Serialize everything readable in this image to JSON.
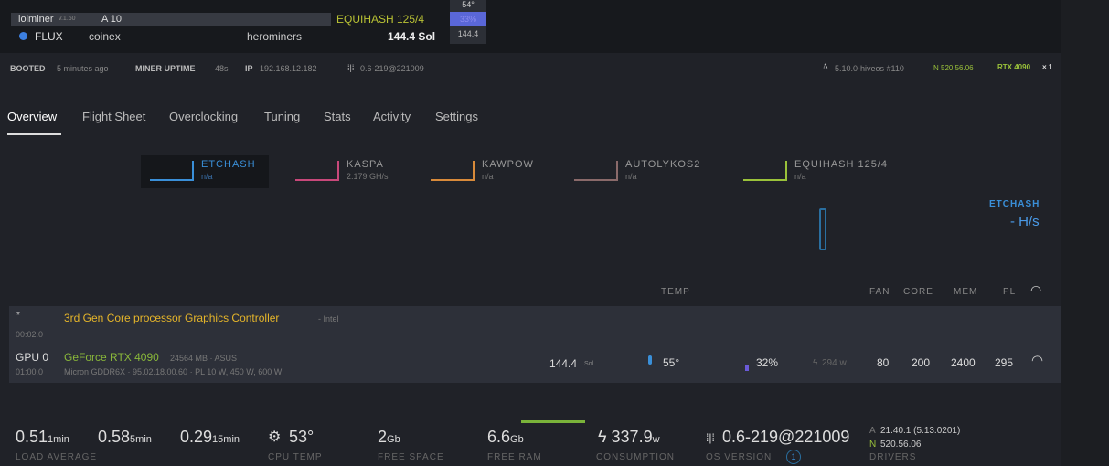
{
  "miner": {
    "name": "lolminer",
    "version": "v.1.60",
    "gpus": "A 10",
    "algo": "EQUIHASH 125/4",
    "coin": "FLUX",
    "wallet": "coinex",
    "pool": "herominers",
    "hashrate": "144.4 Sol",
    "mini_temp": "54°",
    "mini_fan": "33%",
    "mini_hash": "144.4"
  },
  "info": {
    "booted_label": "BOOTED",
    "booted": "5 minutes ago",
    "uptime_label": "MINER UPTIME",
    "uptime": "48s",
    "ip_label": "IP",
    "ip": "192.168.12.182",
    "os": "0.6-219@221009",
    "kernel": "5.10.0-hiveos #110",
    "nvidia": "N 520.56.06",
    "gpu_model": "RTX 4090",
    "gpu_count": "× 1"
  },
  "tabs": [
    "Overview",
    "Flight Sheet",
    "Overclocking",
    "Tuning",
    "Stats",
    "Activity",
    "Settings"
  ],
  "active_tab": 0,
  "algos": [
    {
      "name": "ETCHASH",
      "value": "n/a",
      "color": "#3a8fd8"
    },
    {
      "name": "KASPA",
      "value": "2.179 GH/s",
      "color": "#c8487a"
    },
    {
      "name": "KAWPOW",
      "value": "n/a",
      "color": "#d88a3a"
    },
    {
      "name": "AUTOLYKOS2",
      "value": "n/a",
      "color": "#8a6a6a"
    },
    {
      "name": "EQUIHASH 125/4",
      "value": "n/a",
      "color": "#9ac23a"
    }
  ],
  "chart_label": {
    "algo": "ETCHASH",
    "value": "- H/s"
  },
  "columns": {
    "temp": "TEMP",
    "fan": "FAN",
    "core": "CORE",
    "mem": "MEM",
    "pl": "PL"
  },
  "igpu": {
    "index": "*",
    "bus": "00:02.0",
    "name": "3rd Gen Core processor Graphics Controller",
    "vendor": "- Intel"
  },
  "gpu": {
    "index": "GPU 0",
    "bus": "01:00.0",
    "name": "GeForce RTX 4090",
    "mem": "24564 MB · ASUS",
    "details": "Micron GDDR6X · 95.02.18.00.60 · PL 10 W, 450 W, 600 W",
    "hash": "144.4",
    "hash_unit": "Sol",
    "temp": "55°",
    "fan_pct": "32%",
    "power": "294 w",
    "fan": "80",
    "core": "200",
    "mem_clock": "2400",
    "pl": "295"
  },
  "stats": {
    "load1": "0.51",
    "load1_u": "1min",
    "load5": "0.58",
    "load5_u": "5min",
    "load15": "0.29",
    "load15_u": "15min",
    "load_label": "LOAD AVERAGE",
    "cpu_temp": "53°",
    "cpu_label": "CPU TEMP",
    "free_space": "2",
    "free_space_u": "Gb",
    "free_space_label": "FREE SPACE",
    "free_ram": "6.6",
    "free_ram_u": "Gb",
    "free_ram_label": "FREE RAM",
    "consumption": "337.9",
    "consumption_u": "w",
    "consumption_label": "CONSUMPTION",
    "os": "0.6-219@221009",
    "os_label": "OS VERSION",
    "os_badge": "1",
    "drv_a": "21.40.1 (5.13.0201)",
    "drv_n": "520.56.06",
    "drivers_label": "DRIVERS"
  }
}
